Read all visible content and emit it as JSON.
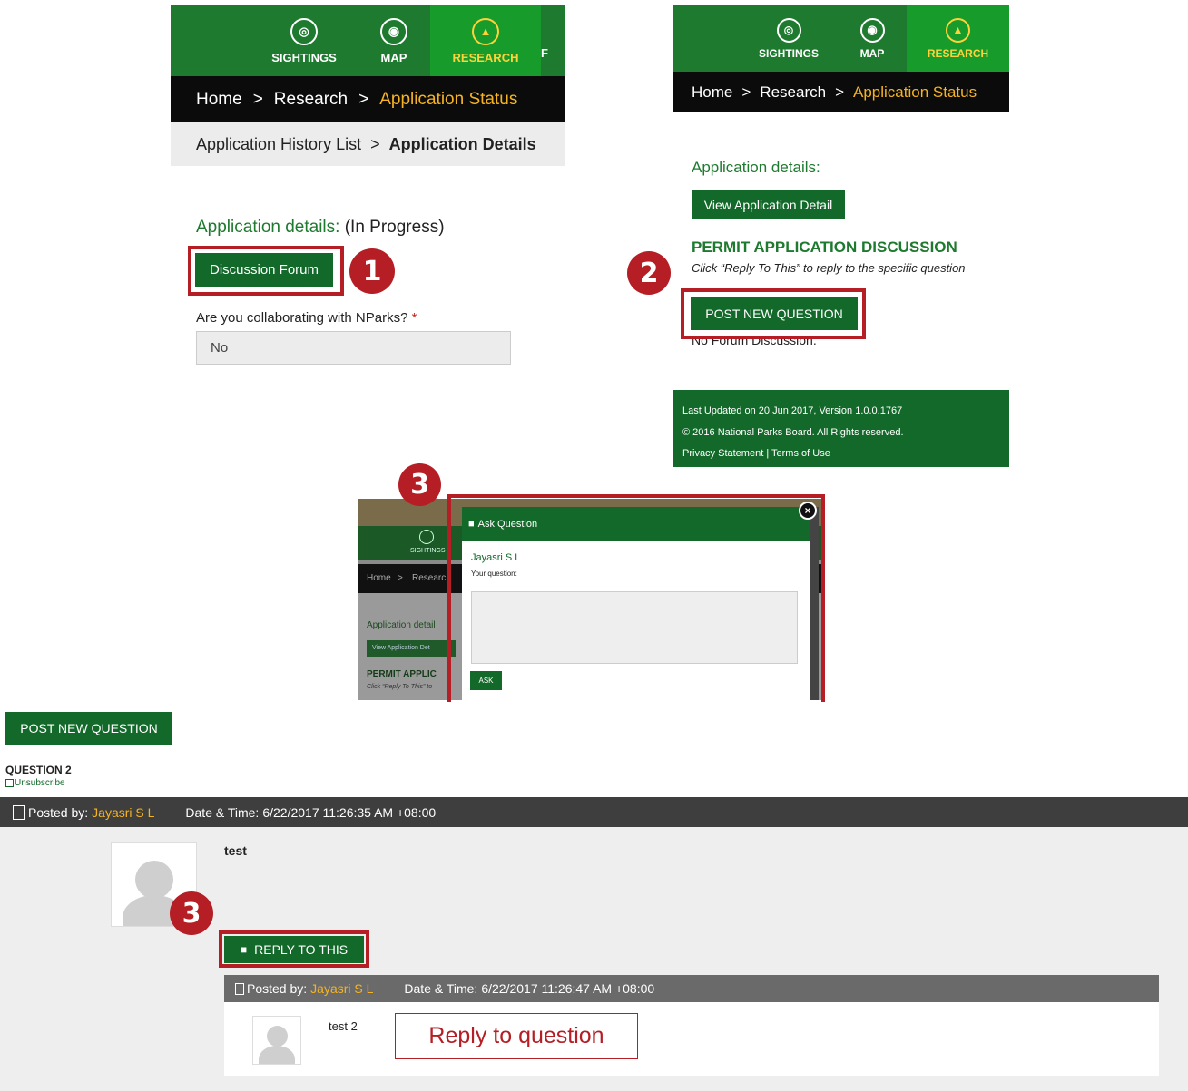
{
  "panel1": {
    "nav": [
      "SIGHTINGS",
      "MAP",
      "RESEARCH"
    ],
    "breadcrumb": {
      "home": "Home",
      "sep": ">",
      "research": "Research",
      "current": "Application Status"
    },
    "sub_breadcrumb": {
      "list": "Application History List",
      "sep": ">",
      "details": "Application Details"
    },
    "details_label": "Application details:",
    "details_status": "(In Progress)",
    "discussion_button": "Discussion Forum",
    "step_badge": "1",
    "collab_question": "Are you collaborating with NParks?",
    "required_mark": "*",
    "collab_value": "No"
  },
  "panel2": {
    "nav": [
      "SIGHTINGS",
      "MAP",
      "RESEARCH"
    ],
    "breadcrumb": {
      "home": "Home",
      "sep": ">",
      "research": "Research",
      "current": "Application Status"
    },
    "details_label": "Application details:",
    "view_button": "View Application Detail",
    "discussion_title": "PERMIT APPLICATION DISCUSSION",
    "discussion_hint": "Click “Reply To This” to reply to the specific question",
    "post_button": "POST NEW QUESTION",
    "no_discussion": "No Forum Discussion.",
    "step_badge": "2",
    "footer": {
      "updated": "Last Updated on 20 Jun 2017, Version 1.0.0.1767",
      "copyright": "© 2016 National Parks Board. All Rights reserved.",
      "links": "Privacy Statement | Terms of Use"
    }
  },
  "panel3": {
    "step_badge": "3",
    "bg": {
      "nav_label": "SIGHTINGS",
      "bc_home": "Home",
      "bc_sep": ">",
      "bc_research": "Researc",
      "details_label": "Application detail",
      "view_button": "View Application Det",
      "discussion_title": "PERMIT APPLIC",
      "hint": "Click “Reply To This” to"
    },
    "modal": {
      "title": "Ask Question",
      "user": "Jayasri S L",
      "question_label": "Your question:",
      "question_value": "",
      "ask_button": "ASK"
    }
  },
  "forum": {
    "post_button": "POST NEW QUESTION",
    "question_title": "QUESTION 2",
    "unsubscribe": "Unsubscribe",
    "post": {
      "posted_by_label": "Posted by:",
      "author": "Jayasri S L",
      "datetime_label": "Date & Time:",
      "datetime": "6/22/2017 11:26:35 AM +08:00",
      "text": "test"
    },
    "reply_button": "REPLY TO THIS",
    "step_badge": "3",
    "reply": {
      "posted_by_label": "Posted by:",
      "author": "Jayasri S L",
      "datetime_label": "Date & Time:",
      "datetime": "6/22/2017 11:26:47 AM +08:00",
      "text": "test 2"
    },
    "callout": "Reply to question"
  },
  "colors": {
    "green": "#13692a",
    "nav_green": "#1e7a2f",
    "highlight_red": "#b41e24",
    "gold": "#f5b324"
  }
}
